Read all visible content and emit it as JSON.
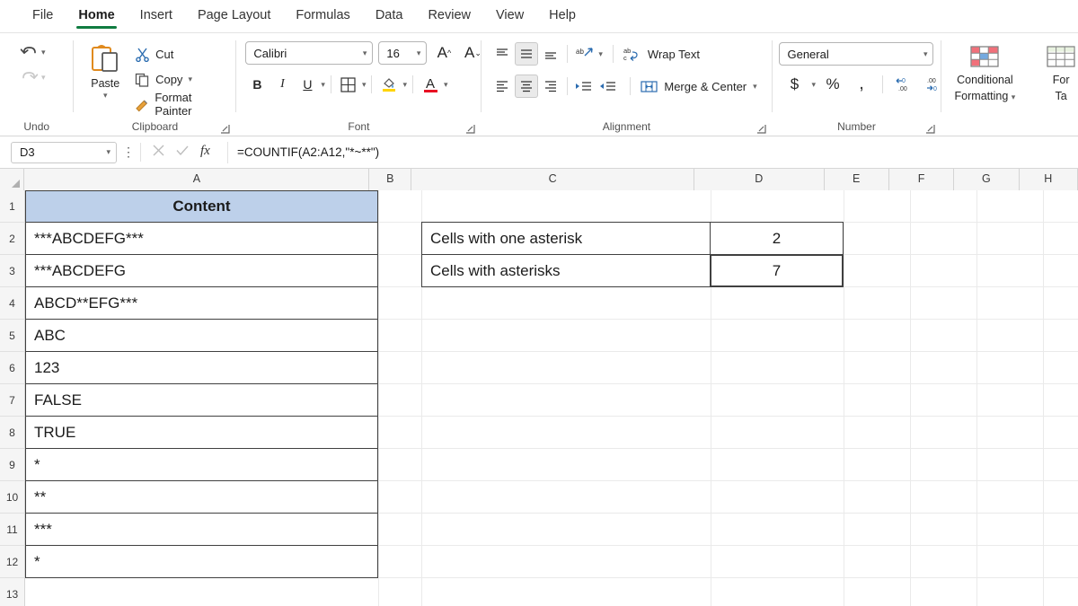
{
  "app": {
    "tabs": [
      {
        "label": "File",
        "active": false
      },
      {
        "label": "Home",
        "active": true
      },
      {
        "label": "Insert",
        "active": false
      },
      {
        "label": "Page Layout",
        "active": false
      },
      {
        "label": "Formulas",
        "active": false
      },
      {
        "label": "Data",
        "active": false
      },
      {
        "label": "Review",
        "active": false
      },
      {
        "label": "View",
        "active": false
      },
      {
        "label": "Help",
        "active": false
      }
    ],
    "accent_color": "#107c41"
  },
  "ribbon": {
    "undo": {
      "label": "Undo",
      "undo_icon": "undo-arrow-icon",
      "redo_icon": "redo-arrow-icon"
    },
    "clipboard": {
      "label": "Clipboard",
      "paste_label": "Paste",
      "cut_label": "Cut",
      "copy_label": "Copy",
      "format_painter_label": "Format Painter"
    },
    "font": {
      "label": "Font",
      "font_name": "Calibri",
      "font_size": "16",
      "grow_font": "A",
      "shrink_font": "A",
      "bold": "B",
      "italic": "I",
      "underline": "U",
      "fill_color": "A",
      "font_color": "A"
    },
    "alignment": {
      "label": "Alignment",
      "wrap_text_label": "Wrap Text",
      "merge_center_label": "Merge & Center",
      "orientation_label": "ab"
    },
    "number": {
      "label": "Number",
      "format": "General",
      "currency": "$",
      "percent": "%",
      "comma": ",",
      "decrease_decimal": ".00",
      "increase_decimal": ".00"
    },
    "styles": {
      "conditional_formatting_label": "Conditional\nFormatting",
      "conditional_formatting_line1": "Conditional",
      "conditional_formatting_line2": "Formatting",
      "format_table_line1": "For",
      "format_table_line2": "Ta"
    }
  },
  "formula_bar": {
    "name_box": "D3",
    "cancel_icon": "cancel-x-icon",
    "enter_icon": "confirm-check-icon",
    "fx_icon": "insert-function-icon",
    "formula": "=COUNTIF(A2:A12,\"*~**\")"
  },
  "grid": {
    "columns": [
      "A",
      "B",
      "C",
      "D",
      "E",
      "F",
      "G",
      "H"
    ],
    "rows": [
      "1",
      "2",
      "3",
      "4",
      "5",
      "6",
      "7",
      "8",
      "9",
      "10",
      "11",
      "12",
      "13"
    ],
    "column_a": {
      "header": "Content",
      "header_fill": "#bdd0ea",
      "values": [
        "***ABCDEFG***",
        "***ABCDEFG",
        "ABCD**EFG***",
        "ABC",
        "123",
        "FALSE",
        "TRUE",
        "*",
        "**",
        "***",
        "*"
      ]
    },
    "result_table": {
      "rows": [
        {
          "label": "Cells with one asterisk",
          "value": "2"
        },
        {
          "label": "Cells with asterisks",
          "value": "7"
        }
      ]
    },
    "selected_cell": "D3"
  }
}
